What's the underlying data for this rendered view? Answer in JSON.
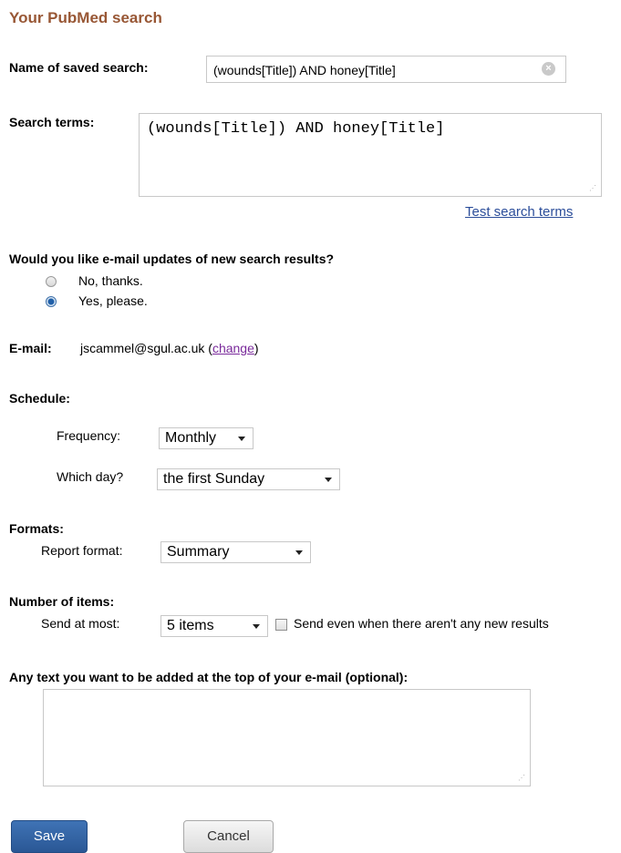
{
  "page_title": "Your PubMed search",
  "name_section": {
    "label": "Name of saved search:",
    "value": "(wounds[Title]) AND honey[Title]"
  },
  "terms_section": {
    "label": "Search terms:",
    "value": "(wounds[Title]) AND honey[Title]",
    "test_link": "Test search terms"
  },
  "updates": {
    "question": "Would you like e-mail updates of new search results?",
    "options": [
      {
        "label": "No, thanks.",
        "selected": false
      },
      {
        "label": "Yes, please.",
        "selected": true
      }
    ]
  },
  "email": {
    "label": "E-mail:",
    "address": "jscammel@sgul.ac.uk",
    "open_paren": "(",
    "change_link": "change",
    "close_paren": ")"
  },
  "schedule": {
    "heading": "Schedule:",
    "frequency_label": "Frequency:",
    "frequency_value": "Monthly",
    "day_label": "Which day?",
    "day_value": "the first Sunday"
  },
  "formats": {
    "heading": "Formats:",
    "report_label": "Report format:",
    "report_value": "Summary"
  },
  "items": {
    "heading": "Number of items:",
    "send_label": "Send at most:",
    "send_value": "5 items",
    "send_empty_label": "Send even when there aren't any new results"
  },
  "extra_text": {
    "label": "Any text you want to be added at the top of your e-mail (optional):",
    "value": ""
  },
  "buttons": {
    "save": "Save",
    "cancel": "Cancel"
  },
  "colors": {
    "title": "#985735",
    "link": "#2b4d9a",
    "save_button": "#2f609f"
  }
}
